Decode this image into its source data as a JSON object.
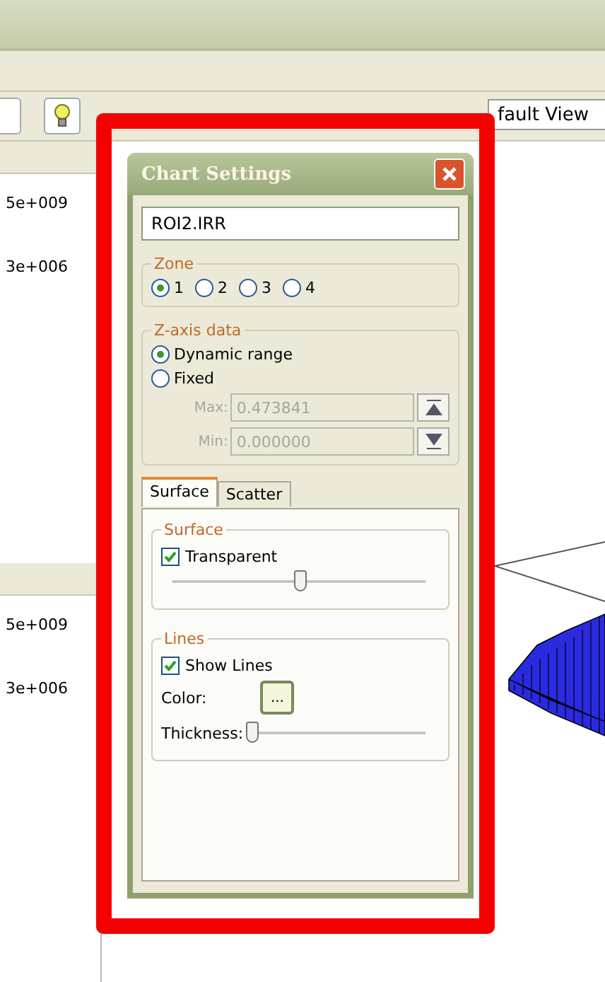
{
  "toolbar": {
    "view_field": "fault View"
  },
  "left_panel": {
    "sections": [
      {
        "values": [
          "5e+009",
          "3e+006"
        ]
      },
      {
        "values": [
          "5e+009",
          "3e+006"
        ]
      }
    ]
  },
  "dialog": {
    "title": "Chart Settings",
    "name_field": "ROI2.IRR",
    "zone": {
      "legend": "Zone",
      "options": [
        {
          "label": "1",
          "selected": true
        },
        {
          "label": "2",
          "selected": false
        },
        {
          "label": "3",
          "selected": false
        },
        {
          "label": "4",
          "selected": false
        }
      ]
    },
    "z_axis": {
      "legend": "Z-axis data",
      "options": [
        {
          "label": "Dynamic range",
          "selected": true
        },
        {
          "label": "Fixed",
          "selected": false
        }
      ],
      "limits": [
        {
          "label": "Max:",
          "value": "0.473841",
          "disabled": true
        },
        {
          "label": "Min:",
          "value": "0.000000",
          "disabled": true
        }
      ]
    },
    "tabs": [
      {
        "label": "Surface",
        "selected": true
      },
      {
        "label": "Scatter",
        "selected": false
      }
    ],
    "surface": {
      "legend": "Surface",
      "checkbox": {
        "label": "Transparent",
        "checked": true
      },
      "level": 0.5
    },
    "lines": {
      "legend": "Lines",
      "checkbox": {
        "label": "Show Lines",
        "checked": true
      },
      "color_label": "Color:",
      "color_button": "...",
      "thickness_label": "Thickness:",
      "level": 0.0
    }
  }
}
